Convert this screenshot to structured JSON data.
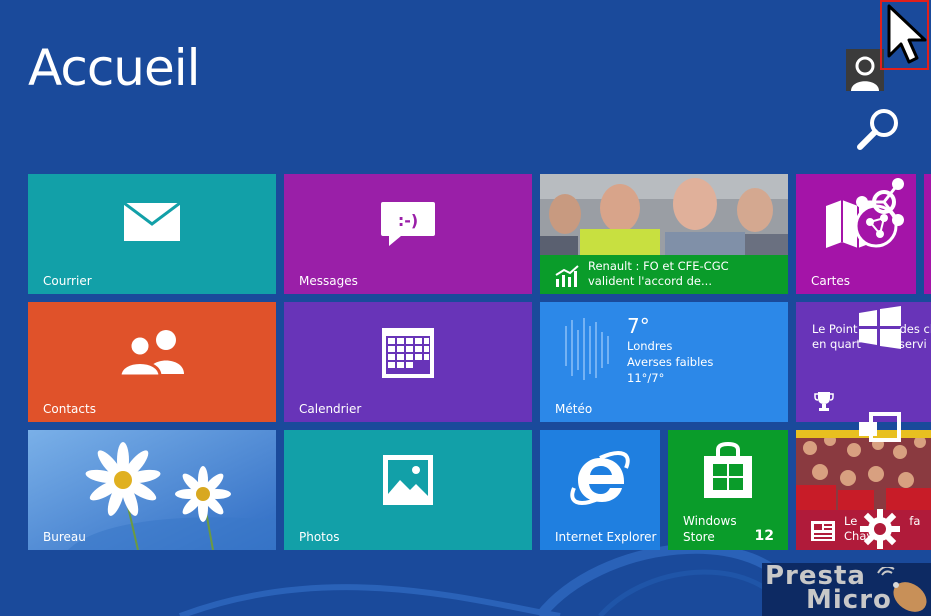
{
  "screen": {
    "title": "Accueil"
  },
  "tiles": {
    "courrier": {
      "label": "Courrier",
      "color": "#12a0a8"
    },
    "messages": {
      "label": "Messages",
      "color": "#9a1fa8"
    },
    "news": {
      "label": "Renault : FO et CFE-CGC valident l'accord de...",
      "line1": "Renault : FO et CFE-CGC",
      "line2": "valident l'accord de...",
      "color": "#0a9c2a"
    },
    "cartes": {
      "label": "Cartes",
      "color": "#a414a8"
    },
    "contacts": {
      "label": "Contacts",
      "color": "#e0522a"
    },
    "calendrier": {
      "label": "Calendrier",
      "color": "#6834b8"
    },
    "meteo": {
      "label": "Météo",
      "temp": "7°",
      "city": "Londres",
      "condition": "Averses faibles",
      "range": "11°/7°",
      "color": "#2c88e8"
    },
    "sport": {
      "line1": "Le Point",
      "line1b": "des ch",
      "line2": "en quart",
      "line2b": "servi",
      "color": "#6834b8"
    },
    "bureau": {
      "label": "Bureau",
      "color": "#4a8ad8"
    },
    "photos": {
      "label": "Photos",
      "color": "#12a0a8"
    },
    "ie": {
      "label": "Internet Explorer",
      "color": "#1f7fe0"
    },
    "store": {
      "label1": "Windows",
      "label2": "Store",
      "badge": "12",
      "color": "#0a9c2a"
    },
    "news2": {
      "line1": "Le",
      "line1b": "fa",
      "line2": "Chav",
      "color": "#b01b3a"
    }
  },
  "watermark": {
    "line1": "Presta",
    "line2": "Micro"
  }
}
